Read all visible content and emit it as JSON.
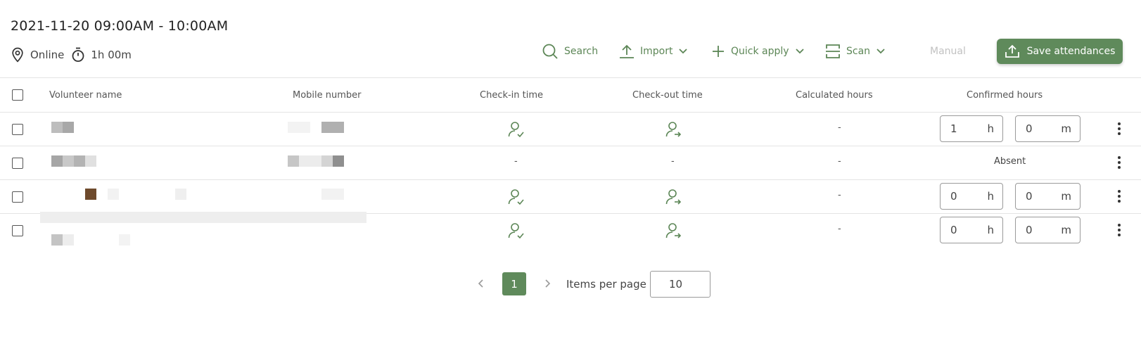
{
  "header": {
    "title": "2021-11-20 09:00AM - 10:00AM",
    "location": "Online",
    "duration": "1h 00m"
  },
  "toolbar": {
    "search": "Search",
    "import": "Import",
    "quick_apply": "Quick apply",
    "scan": "Scan",
    "manual": "Manual",
    "save": "Save attendances"
  },
  "table": {
    "columns": [
      "Volunteer name",
      "Mobile number",
      "Check-in time",
      "Check-out time",
      "Calculated hours",
      "Confirmed hours"
    ],
    "rows": [
      {
        "checkin": "icon",
        "checkout": "icon",
        "calculated": "-",
        "hours": "1",
        "minutes": "0",
        "hours_unit": "h",
        "minutes_unit": "m"
      },
      {
        "checkin": "-",
        "checkout": "-",
        "calculated": "-",
        "status": "Absent"
      },
      {
        "checkin": "icon",
        "checkout": "icon",
        "calculated": "-",
        "hours": "0",
        "minutes": "0",
        "hours_unit": "h",
        "minutes_unit": "m"
      },
      {
        "checkin": "icon",
        "checkout": "icon",
        "calculated": "-",
        "hours": "0",
        "minutes": "0",
        "hours_unit": "h",
        "minutes_unit": "m"
      }
    ]
  },
  "pagination": {
    "current_page": "1",
    "items_per_page_label": "Items per page",
    "items_per_page": "10"
  },
  "colors": {
    "accent": "#5f8a5b",
    "icon_green": "#5c8656"
  },
  "icons": [
    "location-pin-icon",
    "stopwatch-icon",
    "search-icon",
    "upload-icon",
    "plus-icon",
    "scan-icon",
    "chevron-down-icon",
    "user-check-icon",
    "user-arrow-icon",
    "kebab-icon",
    "chevron-left-icon",
    "chevron-right-icon"
  ]
}
